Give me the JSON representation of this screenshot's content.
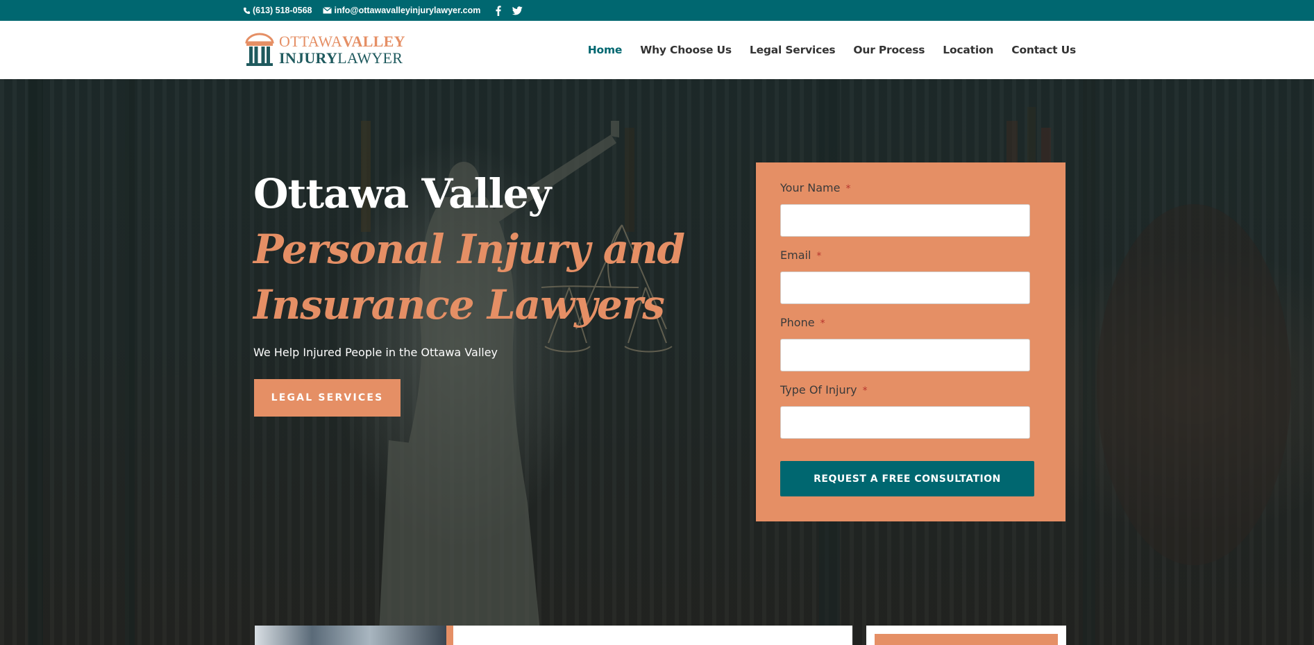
{
  "topbar": {
    "phone": "(613) 518-0568",
    "email": "info@ottawavalleyinjurylawyer.com",
    "social": [
      "facebook-icon",
      "twitter-icon"
    ],
    "background": "#006770"
  },
  "logo": {
    "line1_a": "OTTAWA",
    "line1_b": "VALLEY",
    "line2_a": "INJURY",
    "line2_b": "LAWYER"
  },
  "nav": {
    "items": [
      "Home",
      "Why Choose Us",
      "Legal Services",
      "Our Process",
      "Location",
      "Contact Us"
    ],
    "active": "Home",
    "active_color": "#006770"
  },
  "hero": {
    "title_plain": "Ottawa Valley ",
    "title_highlight": "Personal Injury and Insurance Lawyers",
    "subtitle": "We Help Injured People in the Ottawa Valley",
    "button": "LEGAL SERVICES",
    "accent": "#e58f65"
  },
  "form": {
    "fields": [
      {
        "label": "Your Name",
        "required": "*",
        "value": ""
      },
      {
        "label": "Email",
        "required": "*",
        "value": ""
      },
      {
        "label": "Phone",
        "required": "*",
        "value": ""
      },
      {
        "label": "Type Of Injury",
        "required": "*",
        "value": ""
      }
    ],
    "submit": "REQUEST A FREE CONSULTATION",
    "background": "#e58f65"
  }
}
